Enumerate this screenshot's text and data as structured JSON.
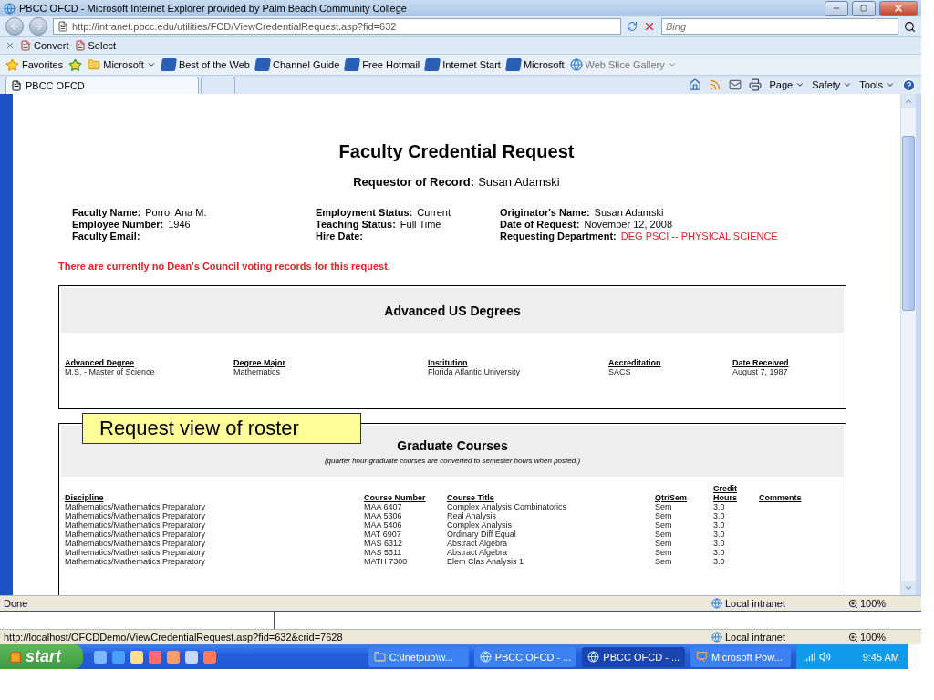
{
  "window": {
    "title": "PBCC OFCD - Microsoft Internet Explorer provided by Palm Beach Community College"
  },
  "address": {
    "url": "http://intranet.pbcc.edu/utilities/FCD/ViewCredentialRequest.asp?fid=632",
    "search_placeholder": "Bing"
  },
  "addon_bar": {
    "items": [
      "Convert",
      "Select"
    ]
  },
  "favorites_bar": {
    "label": "Favorites",
    "items": [
      {
        "kind": "folder",
        "label": "Microsoft"
      },
      {
        "kind": "link",
        "label": "Best of the Web"
      },
      {
        "kind": "link",
        "label": "Channel Guide"
      },
      {
        "kind": "link",
        "label": "Free Hotmail"
      },
      {
        "kind": "link",
        "label": "Internet Start"
      },
      {
        "kind": "link",
        "label": "Microsoft"
      },
      {
        "kind": "slice",
        "label": "Web Slice Gallery"
      }
    ]
  },
  "tabs": [
    {
      "label": "PBCC OFCD",
      "selected": true
    },
    {
      "selected": false
    }
  ],
  "command_bar": [
    "Page",
    "Safety",
    "Tools"
  ],
  "page": {
    "title": "Faculty Credential Request",
    "requestor": {
      "label": "Requestor of Record:",
      "value": "Susan Adamski"
    },
    "info_columns": [
      [
        {
          "label": "Faculty Name:",
          "value": "Porro, Ana M.",
          "color": "#000000"
        },
        {
          "label": "Employee Number:",
          "value": "1946",
          "color": "#000000"
        },
        {
          "label": "Faculty Email:"
        }
      ],
      [
        {
          "label": "Employment Status:",
          "value": "Current",
          "color": "#000000"
        },
        {
          "label": "Teaching Status:",
          "value": "Full Time",
          "color": "#000000"
        },
        {
          "label": "Hire Date:"
        }
      ],
      [
        {
          "label": "Originator's Name:",
          "value": "Susan Adamski",
          "color": "#000000"
        },
        {
          "label": "Date of Request:",
          "value": "November 12, 2008",
          "color": "#000000"
        },
        {
          "label": "Requesting Department:",
          "value": "DEG PSCI -- PHYSICAL SCIENCE",
          "color": "#e8202a"
        }
      ]
    ],
    "notice": "There are currently no Dean's Council voting records for this request.",
    "degrees": {
      "title": "Advanced US Degrees",
      "columns": [
        "Advanced Degree",
        "Degree Major",
        "Institution",
        "Accreditation",
        "Date Received"
      ],
      "rows": [
        [
          "M.S. - Master of Science",
          "Mathematics",
          "Florida Atlantic University",
          "SACS",
          "August 7, 1987"
        ]
      ]
    },
    "courses": {
      "title": "Graduate Courses",
      "subtitle": "(quarter hour graduate courses are converted to semester hours when posted.)",
      "columns": [
        "Discipline",
        "Course Number",
        "Course Title",
        "Qtr/Sem",
        "Credit Hours",
        "Comments"
      ],
      "rows": [
        [
          "Mathematics/Mathematics Preparatory",
          "MAA 6407",
          "Complex Analysis Combinatorics",
          "Sem",
          "3.0",
          ""
        ],
        [
          "Mathematics/Mathematics Preparatory",
          "MAA 5306",
          "Real Analysis",
          "Sem",
          "3.0",
          ""
        ],
        [
          "Mathematics/Mathematics Preparatory",
          "MAA 5406",
          "Complex Analysis",
          "Sem",
          "3.0",
          ""
        ],
        [
          "Mathematics/Mathematics Preparatory",
          "MAT 6907",
          "Ordinary Diff Equal",
          "Sem",
          "3.0",
          ""
        ],
        [
          "Mathematics/Mathematics Preparatory",
          "MAS 6312",
          "Abstract Algebra",
          "Sem",
          "3.0",
          ""
        ],
        [
          "Mathematics/Mathematics Preparatory",
          "MAS 5311",
          "Abstract Algebra",
          "Sem",
          "3.0",
          ""
        ],
        [
          "Mathematics/Mathematics Preparatory",
          "MATH 7300",
          "Elem Clas Analysis 1",
          "Sem",
          "3.0",
          ""
        ]
      ]
    }
  },
  "callout": "Request view of roster",
  "status_bar": {
    "text": "Done",
    "zone": "Local intranet",
    "zoom": "100%"
  },
  "outer_status_bar": {
    "text": "http://localhost/OFCDDemo/ViewCredentialRequest.asp?fid=632&crid=7628",
    "zone": "Local intranet",
    "zoom": "100%"
  },
  "taskbar": {
    "start": "start",
    "tasks": [
      {
        "kind": "folder",
        "label": "C:\\Inetpub\\w...",
        "selected": false
      },
      {
        "kind": "browser",
        "label": "PBCC OFCD - ...",
        "selected": false
      },
      {
        "kind": "browser",
        "label": "PBCC OFCD - ...",
        "selected": true
      },
      {
        "kind": "slides",
        "label": "Microsoft Pow...",
        "selected": false
      }
    ],
    "clock": "9:45 AM"
  }
}
